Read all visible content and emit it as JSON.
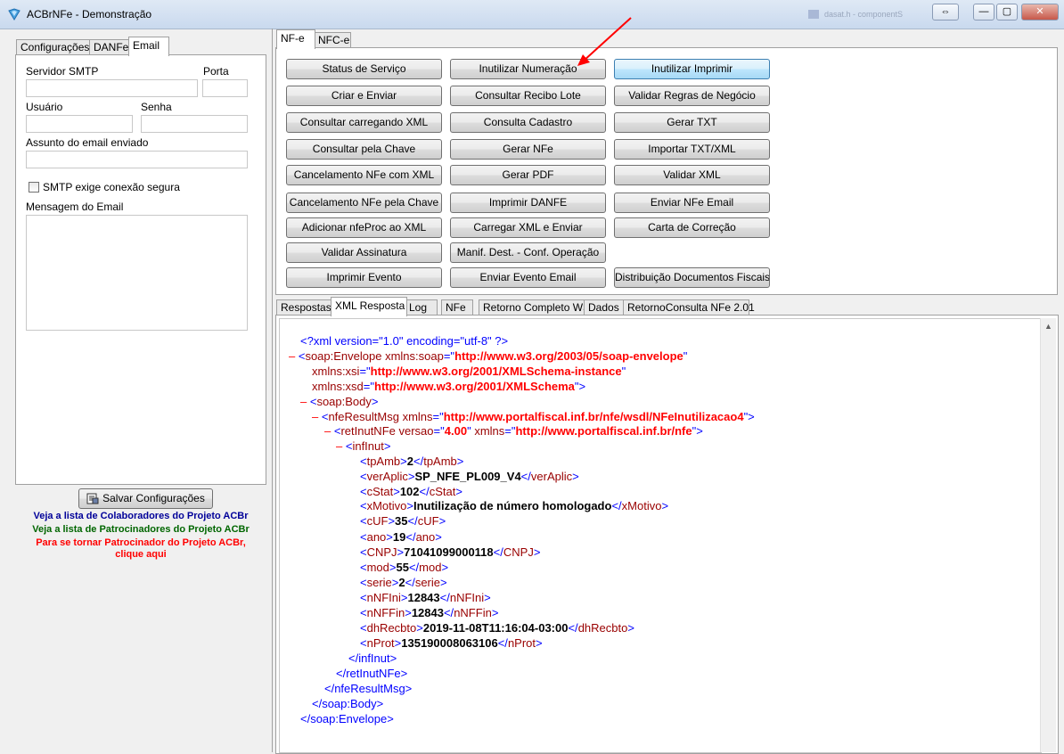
{
  "window": {
    "title": "ACBrNFe - Demonstração",
    "faded_text": "dasat.h - componentS",
    "buttons": {
      "restore_down": "⇔",
      "minimize": "—",
      "maximize": "▢",
      "close": "✕"
    }
  },
  "left": {
    "tabs": [
      "Configurações",
      "DANFe",
      "Email"
    ],
    "active_tab": "Email",
    "labels": {
      "smtp_server": "Servidor SMTP",
      "port": "Porta",
      "user": "Usuário",
      "password": "Senha",
      "subject": "Assunto do email enviado",
      "secure": "SMTP exige conexão segura",
      "message": "Mensagem do Email"
    },
    "save_button": "Salvar Configurações",
    "links": {
      "collaborators": "Veja a lista de Colaboradores do Projeto ACBr",
      "sponsors": "Veja a lista de Patrocinadores do Projeto ACBr",
      "become_sponsor_1": "Para se tornar Patrocinador do Projeto ACBr,",
      "become_sponsor_2": "clique aqui"
    },
    "colors": {
      "collaborators": "#000099",
      "sponsors": "#006600",
      "become_sponsor": "#ff0000"
    }
  },
  "right": {
    "tabs": [
      "NF-e",
      "NFC-e"
    ],
    "active_tab": "NF-e",
    "buttons": {
      "col1": [
        "Status de Serviço",
        "Criar e Enviar",
        "Consultar carregando XML",
        "Consultar pela Chave",
        "Cancelamento NFe com XML",
        "Cancelamento NFe pela Chave",
        "Adicionar nfeProc ao XML",
        "Validar Assinatura",
        "Imprimir Evento"
      ],
      "col2": [
        "Inutilizar Numeração",
        "Consultar Recibo Lote",
        "Consulta Cadastro",
        "Gerar NFe",
        "Gerar PDF",
        "Imprimir DANFE",
        "Carregar XML e Enviar",
        "Manif. Dest. - Conf. Operação",
        "Enviar Evento Email"
      ],
      "col3": [
        "Inutilizar Imprimir",
        "Validar Regras de Negócio",
        "Gerar TXT",
        "Importar TXT/XML",
        "Validar XML",
        "Enviar NFe Email",
        "Carta de Correção",
        "Distribuição Documentos Fiscais"
      ]
    }
  },
  "bottom_tabs": [
    "Respostas",
    "XML Resposta",
    "Log",
    "NFe",
    "Retorno Completo WS",
    "Dados",
    "RetornoConsulta NFe 2.01"
  ],
  "bottom_active_tab": "XML Resposta",
  "xml": {
    "decl": "<?xml version=\"1.0\" encoding=\"utf-8\" ?>",
    "minus": "–",
    "lines": {
      "envelope_tag": "soap:Envelope",
      "xmlns_soap": "xmlns:soap",
      "xmlns_soap_val": "http://www.w3.org/2003/05/soap-envelope",
      "xmlns_xsi": "xmlns:xsi",
      "xmlns_xsi_val": "http://www.w3.org/2001/XMLSchema-instance",
      "xmlns_xsd": "xmlns:xsd",
      "xmlns_xsd_val": "http://www.w3.org/2001/XMLSchema",
      "body_tag": "soap:Body",
      "nferesult_tag": "nfeResultMsg",
      "xmlns": "xmlns",
      "nferesult_ns": "http://www.portalfiscal.inf.br/nfe/wsdl/NFeInutilizacao4",
      "retinut_tag": "retInutNFe",
      "versao": "versao",
      "versao_val": "4.00",
      "retinut_ns": "http://www.portalfiscal.inf.br/nfe",
      "infinut_tag": "infInut"
    },
    "fields": [
      {
        "tag": "tpAmb",
        "value": "2"
      },
      {
        "tag": "verAplic",
        "value": "SP_NFE_PL009_V4"
      },
      {
        "tag": "cStat",
        "value": "102"
      },
      {
        "tag": "xMotivo",
        "value": "Inutilização de número homologado"
      },
      {
        "tag": "cUF",
        "value": "35"
      },
      {
        "tag": "ano",
        "value": "19"
      },
      {
        "tag": "CNPJ",
        "value": "71041099000118"
      },
      {
        "tag": "mod",
        "value": "55"
      },
      {
        "tag": "serie",
        "value": "2"
      },
      {
        "tag": "nNFIni",
        "value": "12843"
      },
      {
        "tag": "nNFFin",
        "value": "12843"
      },
      {
        "tag": "dhRecbto",
        "value": "2019-11-08T11:16:04-03:00"
      },
      {
        "tag": "nProt",
        "value": "135190008063106"
      }
    ],
    "close": {
      "infinut": "</infInut>",
      "retinut": "</retInutNFe>",
      "nferesult": "</nfeResultMsg>",
      "body": "</soap:Body>",
      "envelope": "</soap:Envelope>"
    }
  },
  "colors": {
    "arrow": "#ff0000",
    "markup_blue": "#0000ff",
    "tag_brown": "#990000",
    "value_red": "#ff0000"
  }
}
